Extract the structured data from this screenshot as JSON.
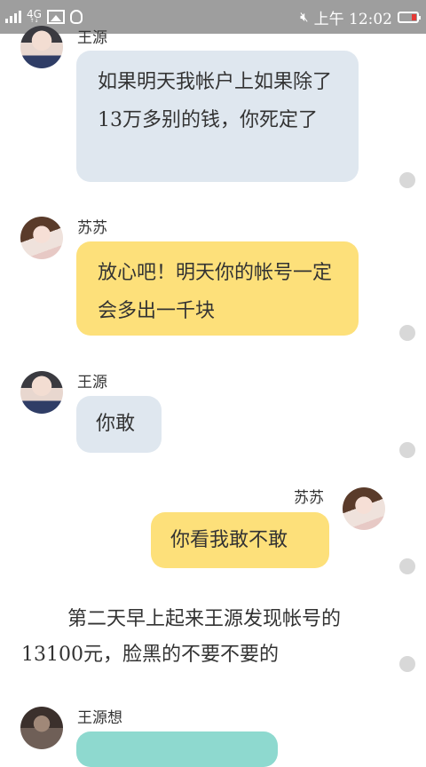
{
  "statusbar": {
    "network": "4G",
    "time": "上午 12:02",
    "icons": [
      "signal-icon",
      "gallery-icon",
      "qq-icon",
      "mute-icon",
      "battery-icon"
    ],
    "battery_color": "#e53935"
  },
  "messages": [
    {
      "sender": "王源",
      "side": "left",
      "text": "如果明天我帐户上如果除了13万多别的钱，你死定了",
      "color": "#dfe7ef"
    },
    {
      "sender": "苏苏",
      "side": "left",
      "text": "放心吧！明天你的帐号一定会多出一千块",
      "color": "#fde07a"
    },
    {
      "sender": "王源",
      "side": "left",
      "text": "你敢",
      "color": "#dfe7ef"
    },
    {
      "sender": "苏苏",
      "side": "right",
      "text": "你看我敢不敢",
      "color": "#fde07a"
    }
  ],
  "narration": "第二天早上起来王源发现帐号的13100元，脸黑的不要不要的",
  "last": {
    "sender": "王源想",
    "text": "",
    "color": "#8ed9cf"
  }
}
